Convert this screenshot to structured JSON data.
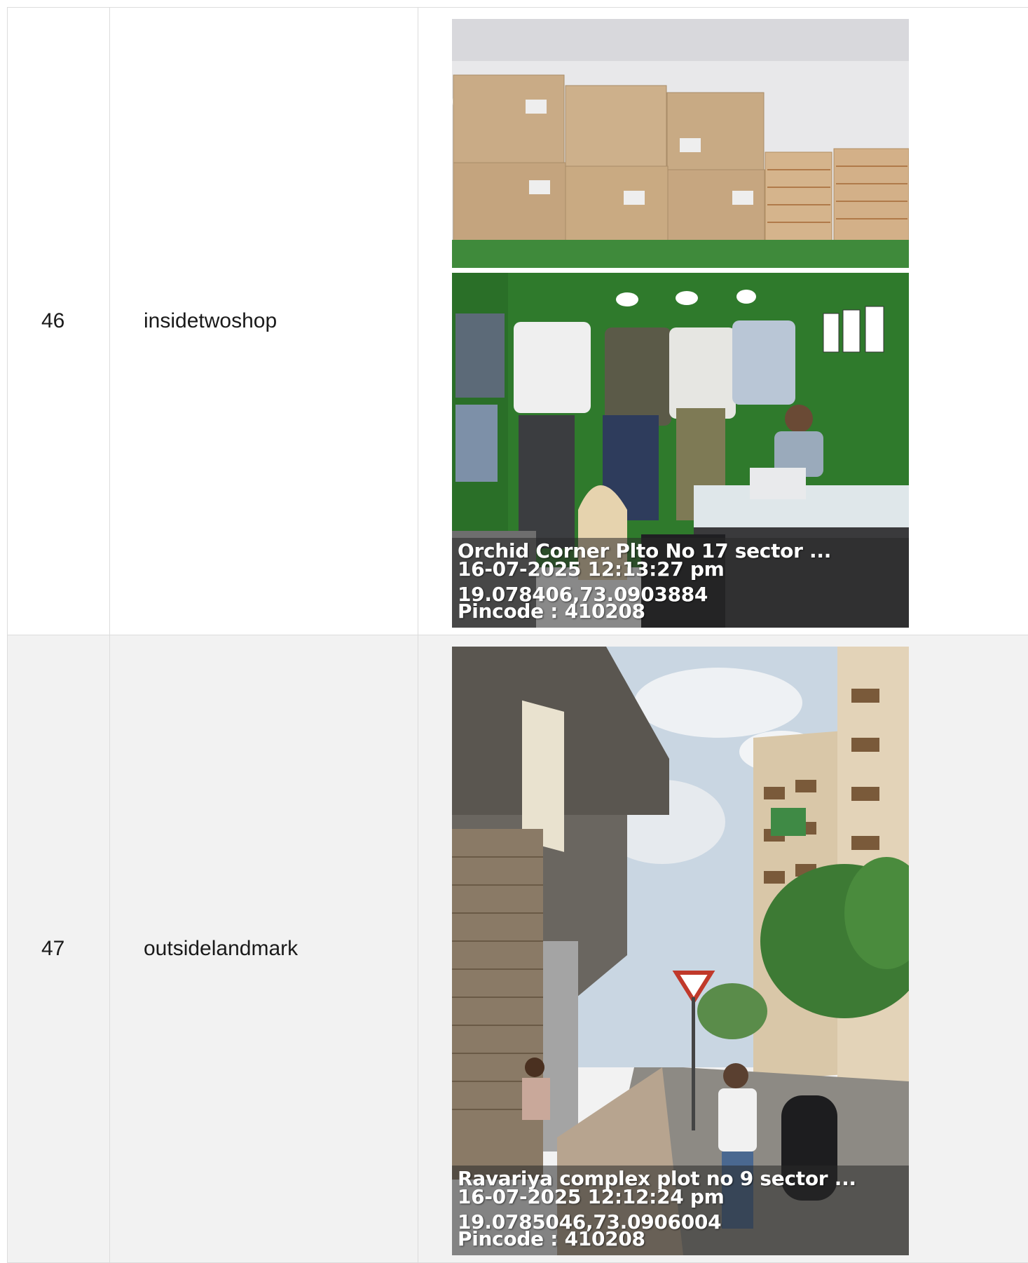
{
  "rows": [
    {
      "number": "46",
      "label": "insidetwoshop",
      "photo": {
        "address": "Orchid Corner Plto No 17 sector ...",
        "datetime": "16-07-2025 12:13:27 pm",
        "coordinates": "19.078406,73.0903884",
        "pincode": "Pincode : 410208"
      }
    },
    {
      "number": "47",
      "label": "outsidelandmark",
      "photo": {
        "address": "Ravariya complex plot no 9 sector ...",
        "datetime": "16-07-2025 12:12:24 pm",
        "coordinates": "19.0785046,73.0906004",
        "pincode": "Pincode : 410208"
      }
    }
  ]
}
